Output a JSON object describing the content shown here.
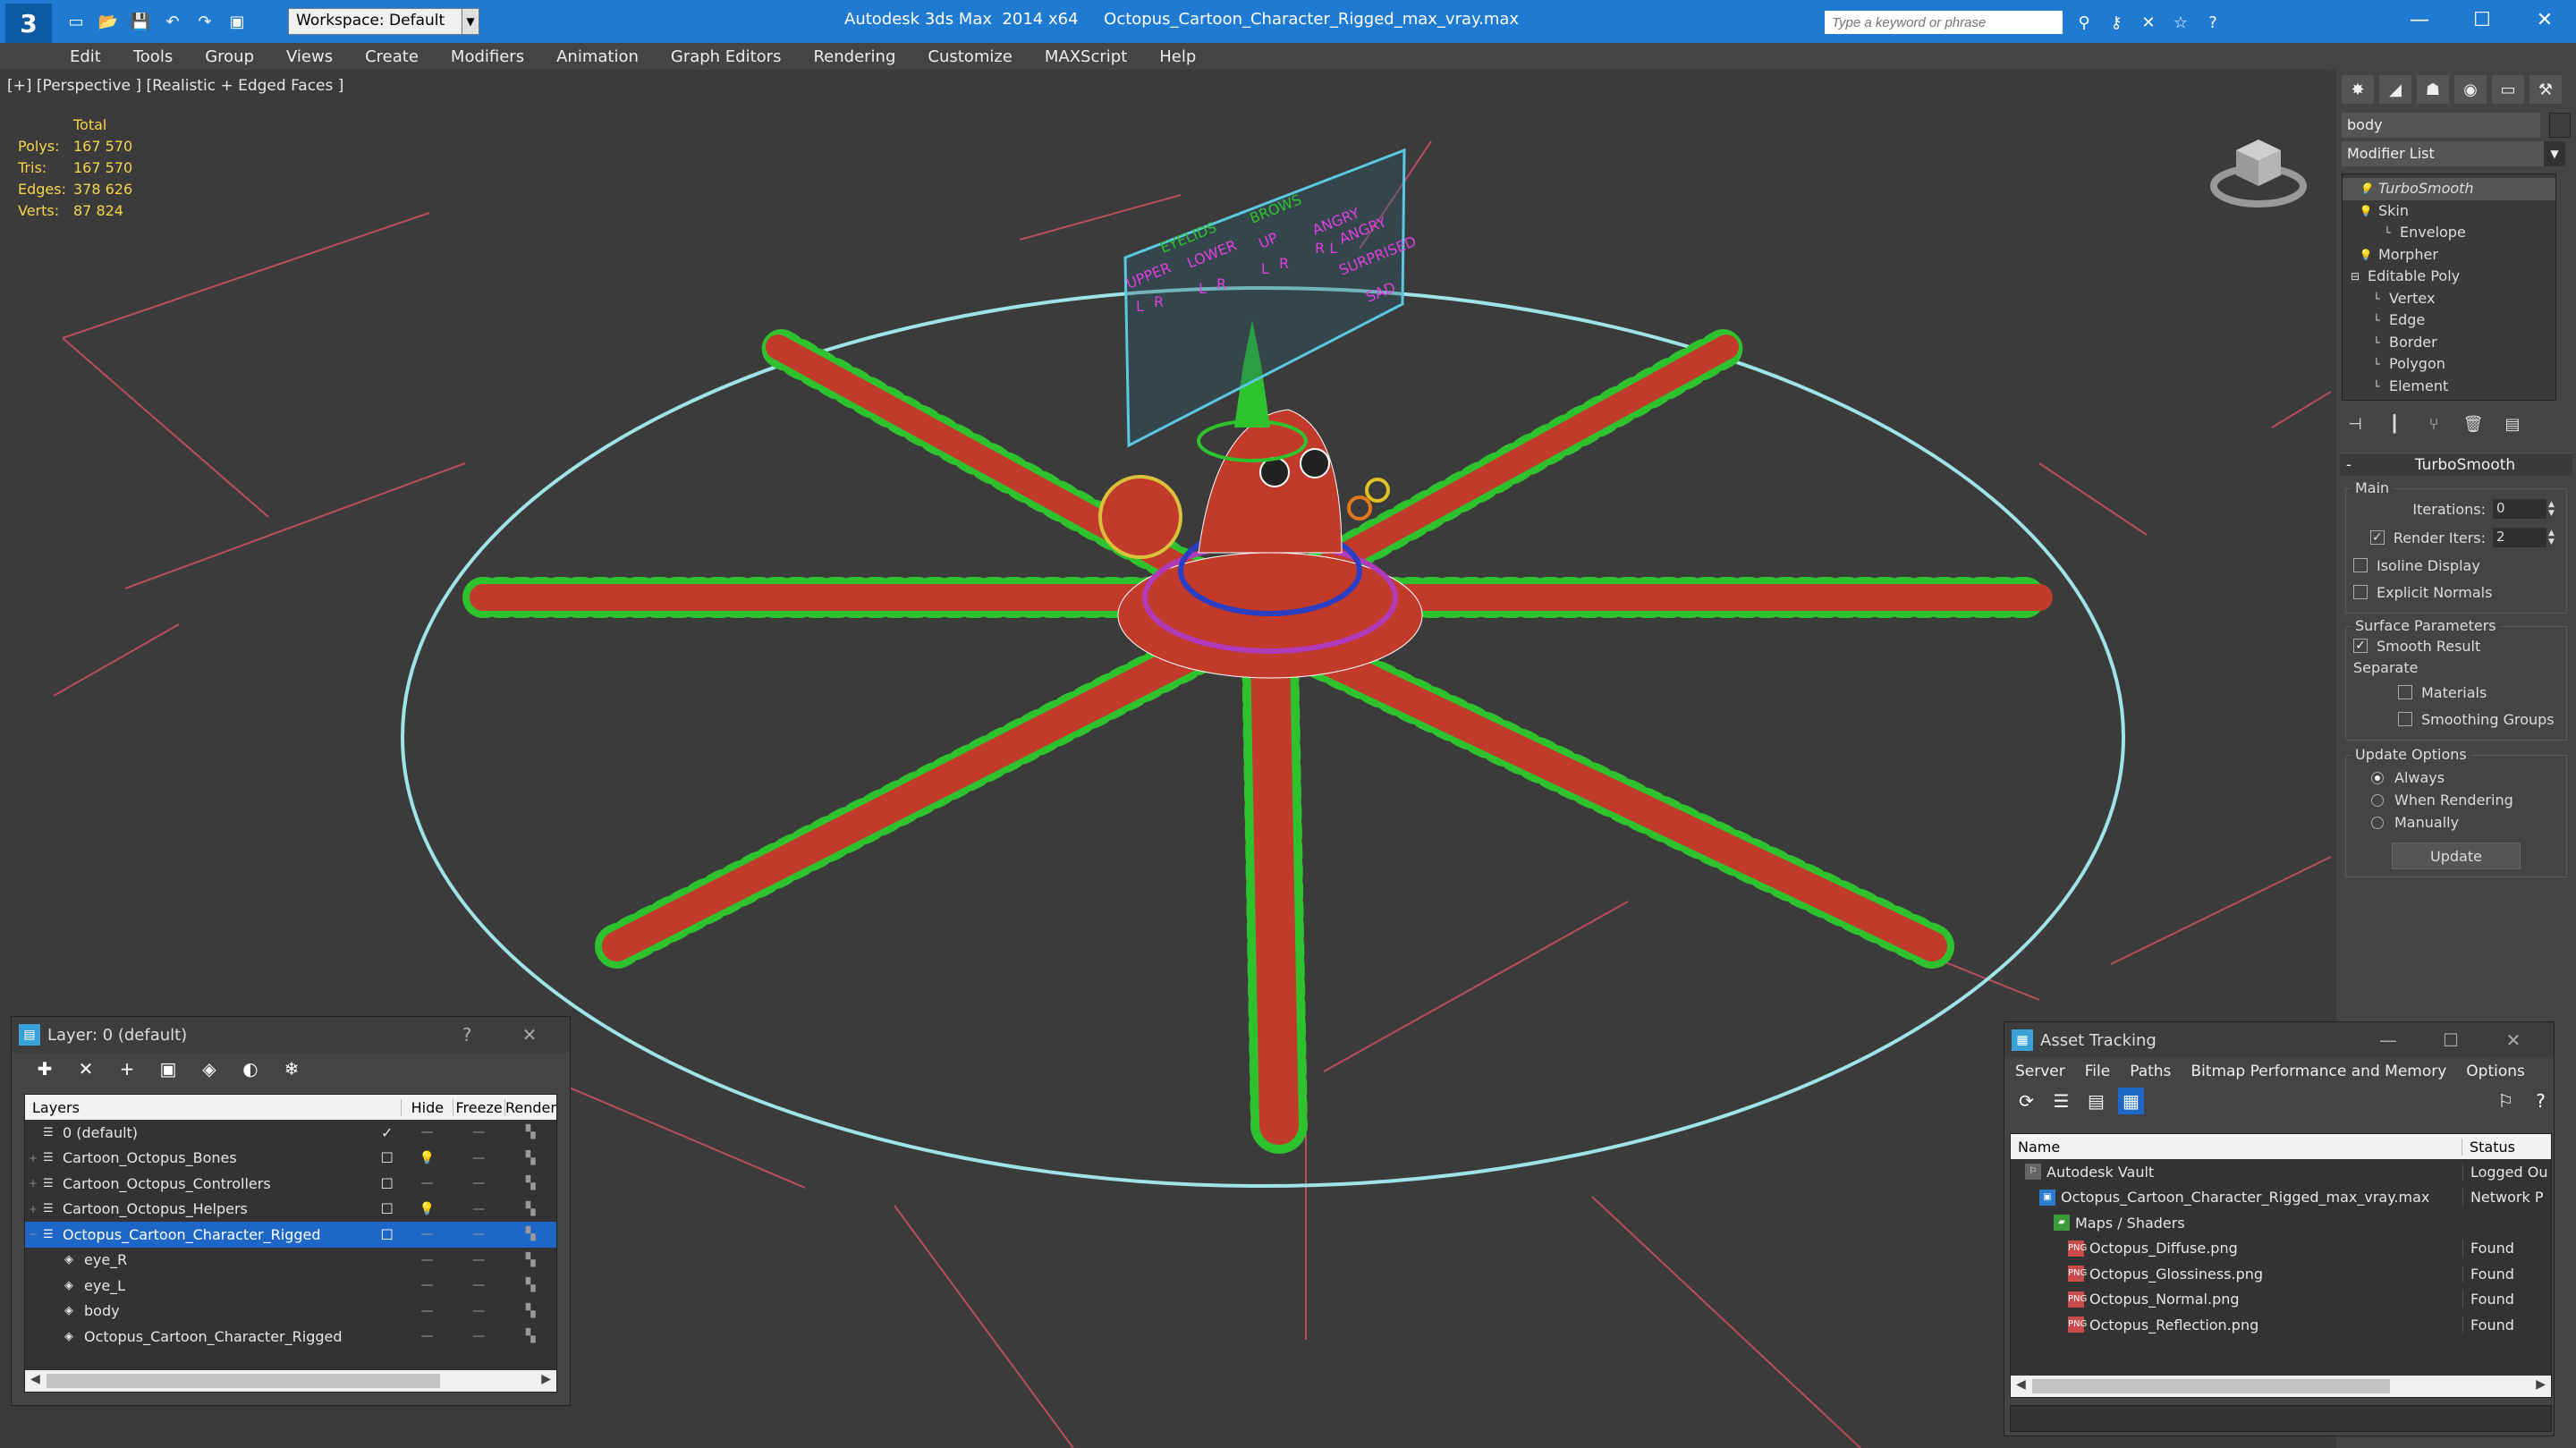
{
  "app": {
    "name": "Autodesk 3ds Max  2014 x64",
    "file": "Octopus_Cartoon_Character_Rigged_max_vray.max",
    "workspace": "Workspace: Default",
    "search_placeholder": "Type a keyword or phrase",
    "logo": "3"
  },
  "menu": [
    "Edit",
    "Tools",
    "Group",
    "Views",
    "Create",
    "Modifiers",
    "Animation",
    "Graph Editors",
    "Rendering",
    "Customize",
    "MAXScript",
    "Help"
  ],
  "viewport": {
    "label": "[+] [Perspective ] [Realistic + Edged Faces ]",
    "stats": {
      "header": "Total",
      "rows": [
        {
          "k": "Polys:",
          "v": "167 570"
        },
        {
          "k": "Tris:",
          "v": "167 570"
        },
        {
          "k": "Edges:",
          "v": "378 626"
        },
        {
          "k": "Verts:",
          "v": "87 824"
        }
      ]
    },
    "face_panel": {
      "labels": [
        "EYELIDS",
        "BROWS",
        "UPPER",
        "LOWER",
        "UP",
        "ANGRY",
        "SURPRISED",
        "SAD",
        "ANGRY",
        "L",
        "R",
        "L",
        "R",
        "L",
        "R",
        "R L"
      ]
    }
  },
  "command_panel": {
    "object_name": "body",
    "modifier_list": "Modifier List",
    "stack": [
      {
        "label": "TurboSmooth",
        "indent": 1,
        "selected": true,
        "icon": "bulb"
      },
      {
        "label": "Skin",
        "indent": 1,
        "selected": false,
        "icon": "bulb-minus"
      },
      {
        "label": "Envelope",
        "indent": 3,
        "selected": false,
        "icon": ""
      },
      {
        "label": "Morpher",
        "indent": 1,
        "selected": false,
        "icon": "bulb"
      },
      {
        "label": "Editable Poly",
        "indent": 0,
        "selected": false,
        "icon": "minus"
      },
      {
        "label": "Vertex",
        "indent": 2,
        "selected": false,
        "icon": ""
      },
      {
        "label": "Edge",
        "indent": 2,
        "selected": false,
        "icon": ""
      },
      {
        "label": "Border",
        "indent": 2,
        "selected": false,
        "icon": ""
      },
      {
        "label": "Polygon",
        "indent": 2,
        "selected": false,
        "icon": ""
      },
      {
        "label": "Element",
        "indent": 2,
        "selected": false,
        "icon": ""
      }
    ],
    "rollout": {
      "title": "TurboSmooth",
      "main_label": "Main",
      "iterations_label": "Iterations:",
      "iterations_value": "0",
      "render_iters_label": "Render Iters:",
      "render_iters_value": "2",
      "isoline": "Isoline Display",
      "explicit": "Explicit Normals",
      "surface_label": "Surface Parameters",
      "smooth_result": "Smooth Result",
      "separate_label": "Separate",
      "materials": "Materials",
      "smoothing_groups": "Smoothing Groups",
      "update_label": "Update Options",
      "always": "Always",
      "when_rendering": "When Rendering",
      "manually": "Manually",
      "update_button": "Update"
    }
  },
  "layer_window": {
    "title": "Layer: 0 (default)",
    "help": "?",
    "close": "✕",
    "columns": [
      "Layers",
      "Hide",
      "Freeze",
      "Render"
    ],
    "rows": [
      {
        "name": "0 (default)",
        "level": 0,
        "expand": "",
        "selected": false,
        "check": "✓",
        "hide": "—",
        "freeze": "—",
        "render": "▚"
      },
      {
        "name": "Cartoon_Octopus_Bones",
        "level": 0,
        "expand": "+",
        "selected": false,
        "check": "☐",
        "hide": "💡",
        "freeze": "—",
        "render": "▚"
      },
      {
        "name": "Cartoon_Octopus_Controllers",
        "level": 0,
        "expand": "+",
        "selected": false,
        "check": "☐",
        "hide": "—",
        "freeze": "—",
        "render": "▚"
      },
      {
        "name": "Cartoon_Octopus_Helpers",
        "level": 0,
        "expand": "+",
        "selected": false,
        "check": "☐",
        "hide": "💡",
        "freeze": "—",
        "render": "▚"
      },
      {
        "name": "Octopus_Cartoon_Character_Rigged",
        "level": 0,
        "expand": "−",
        "selected": true,
        "check": "☐",
        "hide": "—",
        "freeze": "—",
        "render": "▚"
      },
      {
        "name": "eye_R",
        "level": 1,
        "expand": "",
        "selected": false,
        "check": "",
        "hide": "—",
        "freeze": "—",
        "render": "▚"
      },
      {
        "name": "eye_L",
        "level": 1,
        "expand": "",
        "selected": false,
        "check": "",
        "hide": "—",
        "freeze": "—",
        "render": "▚"
      },
      {
        "name": "body",
        "level": 1,
        "expand": "",
        "selected": false,
        "check": "",
        "hide": "—",
        "freeze": "—",
        "render": "▚"
      },
      {
        "name": "Octopus_Cartoon_Character_Rigged",
        "level": 1,
        "expand": "",
        "selected": false,
        "check": "",
        "hide": "—",
        "freeze": "—",
        "render": "▚"
      }
    ]
  },
  "asset_window": {
    "title": "Asset Tracking",
    "menu": [
      "Server",
      "File",
      "Paths",
      "Bitmap Performance and Memory",
      "Options"
    ],
    "columns": [
      "Name",
      "Status"
    ],
    "rows": [
      {
        "name": "Autodesk Vault",
        "level": 1,
        "icon": "vault",
        "status": "Logged Ou"
      },
      {
        "name": "Octopus_Cartoon_Character_Rigged_max_vray.max",
        "level": 2,
        "icon": "max",
        "status": "Network P"
      },
      {
        "name": "Maps / Shaders",
        "level": 3,
        "icon": "maps",
        "status": ""
      },
      {
        "name": "Octopus_Diffuse.png",
        "level": 4,
        "icon": "png",
        "status": "Found"
      },
      {
        "name": "Octopus_Glossiness.png",
        "level": 4,
        "icon": "png",
        "status": "Found"
      },
      {
        "name": "Octopus_Normal.png",
        "level": 4,
        "icon": "png",
        "status": "Found"
      },
      {
        "name": "Octopus_Reflection.png",
        "level": 4,
        "icon": "png",
        "status": "Found"
      }
    ]
  },
  "colors": {
    "titlebar": "#1f7ad1",
    "selection": "#1e67c7",
    "stats": "#f6d44a",
    "tentacle": "#c23a2a",
    "bones": "#2fc22f",
    "grid": "#d9536a",
    "circle": "#9fe3e6"
  }
}
